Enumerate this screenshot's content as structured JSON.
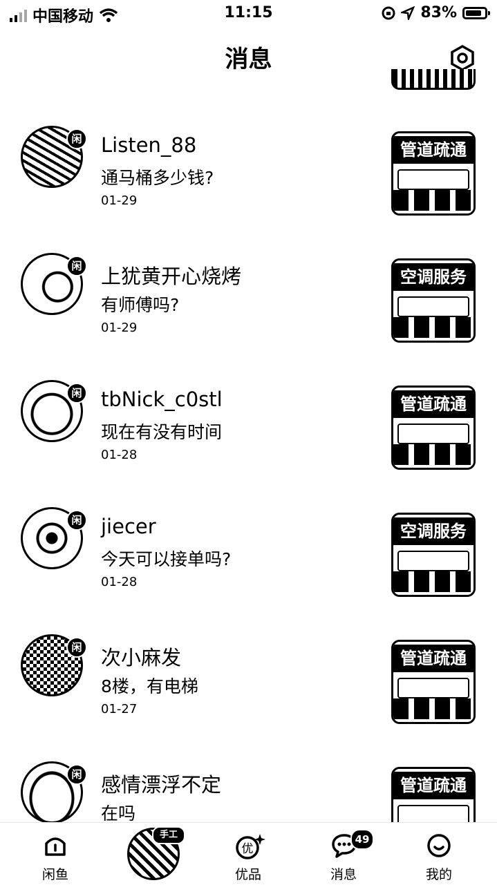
{
  "status_bar": {
    "carrier": "中国移动",
    "time": "11:15",
    "battery_percent": "83%",
    "battery_level": 0.83,
    "icons": [
      "signal-icon",
      "wifi-icon",
      "lock-rotation-icon",
      "location-icon",
      "battery-icon"
    ]
  },
  "header": {
    "title": "消息",
    "settings_icon": "settings-hexagon-icon"
  },
  "conversations": [
    {
      "name": "Listen_88",
      "message": "通马桶多少钱?",
      "date": "01-29",
      "badge": "闲",
      "thumb_text": "管道疏通"
    },
    {
      "name": "上犹黄开心烧烤",
      "message": "有师傅吗?",
      "date": "01-29",
      "badge": "闲",
      "thumb_text": "空调服务"
    },
    {
      "name": "tbNick_c0stl",
      "message": "现在有没有时间",
      "date": "01-28",
      "badge": "闲",
      "thumb_text": "管道疏通"
    },
    {
      "name": "jiecer",
      "message": "今天可以接单吗?",
      "date": "01-28",
      "badge": "闲",
      "thumb_text": "空调服务"
    },
    {
      "name": "次小麻发",
      "message": "8楼，有电梯",
      "date": "01-27",
      "badge": "闲",
      "thumb_text": "管道疏通"
    },
    {
      "name": "感情漂浮不定",
      "message": "在吗",
      "date": "",
      "badge": "闲",
      "thumb_text": "管道疏通"
    }
  ],
  "tabbar": {
    "tabs": [
      {
        "label": "闲鱼",
        "icon": "home-icon"
      },
      {
        "label": "优品",
        "icon": "youpin-icon"
      },
      {
        "label": "消息",
        "icon": "chat-bubble-icon"
      },
      {
        "label": "我的",
        "icon": "profile-smile-icon"
      }
    ],
    "center_tag": "手工",
    "messages_badge": "49"
  }
}
